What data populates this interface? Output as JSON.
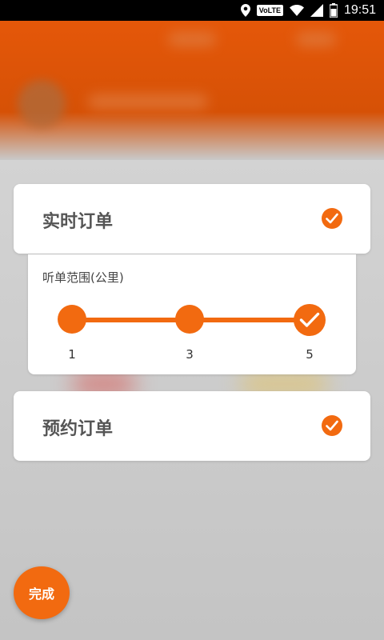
{
  "status_bar": {
    "network_badge": "VoLTE",
    "time": "19:51",
    "icons": [
      "location-icon",
      "volte-icon",
      "wifi-icon",
      "signal-icon",
      "battery-icon"
    ]
  },
  "realtime_order": {
    "title": "实时订单",
    "checked": true
  },
  "range": {
    "title": "听单范围(公里)",
    "ticks": [
      "1",
      "3",
      "5"
    ],
    "selected": "5"
  },
  "reserved_order": {
    "title": "预约订单",
    "checked": true
  },
  "done_button": {
    "label": "完成"
  },
  "colors": {
    "accent": "#f26a10",
    "header": "#d65106",
    "card": "#ffffff",
    "text": "#555555"
  }
}
